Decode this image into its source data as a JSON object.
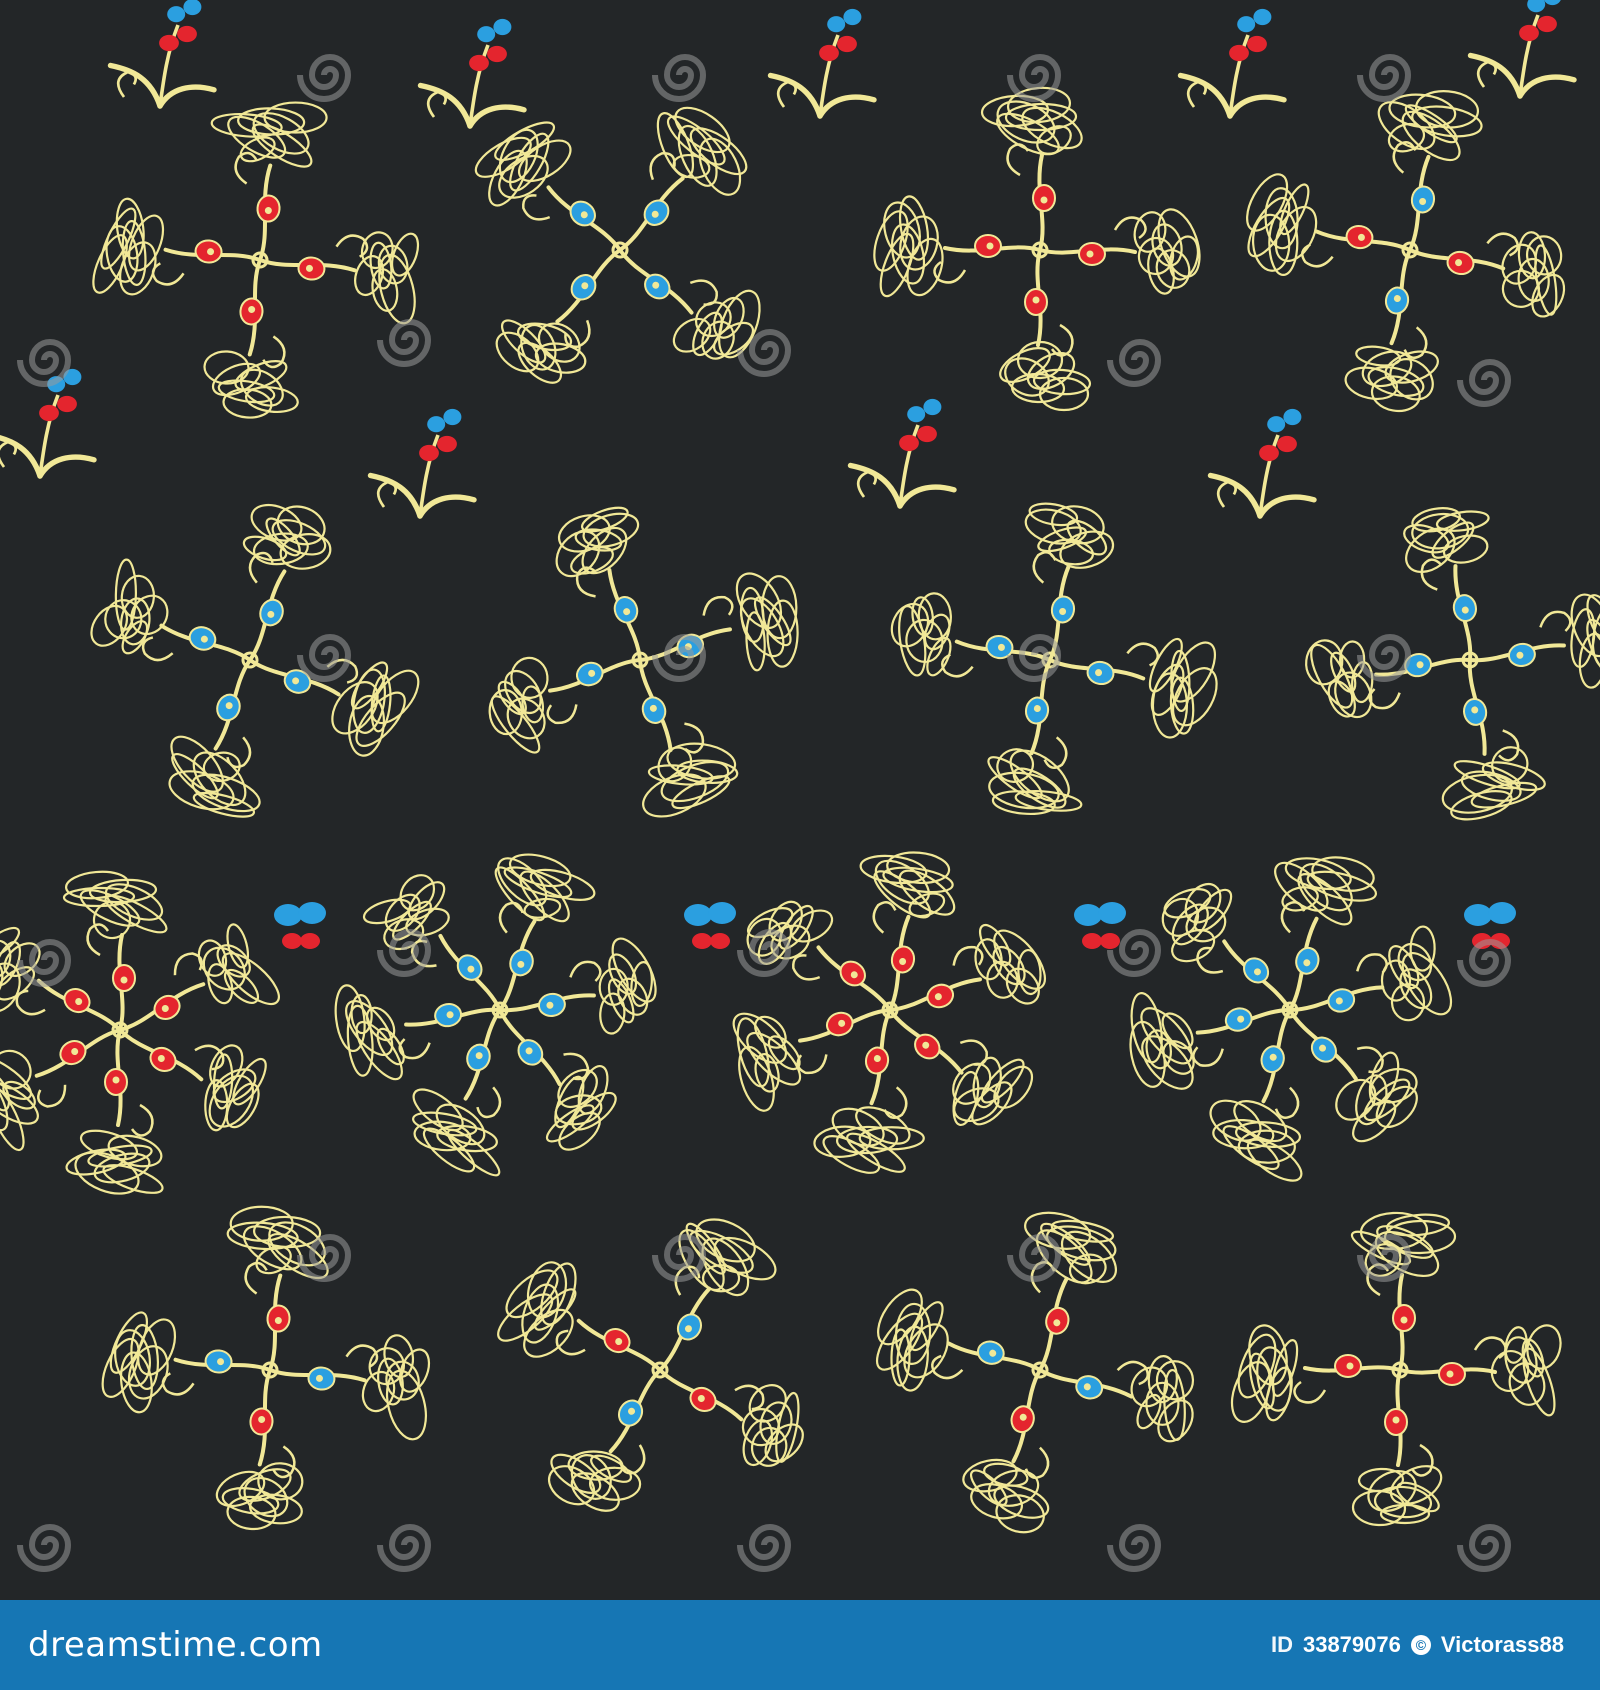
{
  "image": {
    "watermark_text": "dreamstime",
    "colors": {
      "background": "#232628",
      "swirl_yellow": "#f1e897",
      "accent_red": "#e4252e",
      "accent_blue": "#2b9fe0",
      "footer_blue": "#1676b4"
    }
  },
  "footer": {
    "brand": "dreamstime.com",
    "id_label": "ID",
    "id_number": "33879076",
    "author": "Victorass88"
  }
}
